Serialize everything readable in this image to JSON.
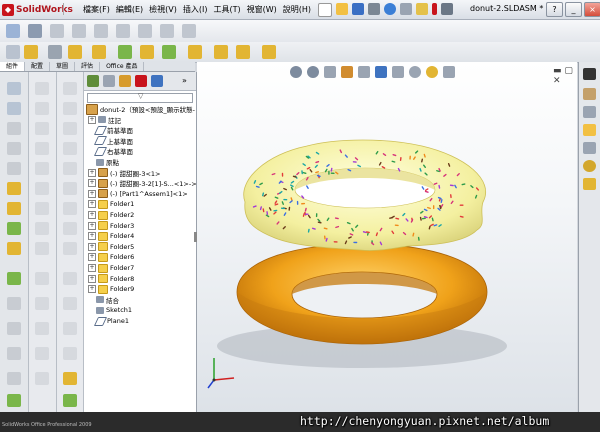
{
  "app": {
    "logo_text": "SolidWorks",
    "document_title": "donut-2.SLDASM *"
  },
  "menus": [
    {
      "label": "檔案(F)"
    },
    {
      "label": "編輯(E)"
    },
    {
      "label": "檢視(V)"
    },
    {
      "label": "插入(I)"
    },
    {
      "label": "工具(T)"
    },
    {
      "label": "視窗(W)"
    },
    {
      "label": "說明(H)"
    }
  ],
  "cmd_tabs": [
    {
      "label": "組件"
    },
    {
      "label": "配置"
    },
    {
      "label": "草圖"
    },
    {
      "label": "評估"
    },
    {
      "label": "Office 產品"
    }
  ],
  "tree": {
    "root": "donut-2（預設<預設_顯示狀態-",
    "nodes": [
      {
        "label": "註記",
        "icon": "annotation-icon",
        "expand": "+"
      },
      {
        "label": "前基準面",
        "icon": "plane-icon",
        "expand": ""
      },
      {
        "label": "上基準面",
        "icon": "plane-icon",
        "expand": ""
      },
      {
        "label": "右基準面",
        "icon": "plane-icon",
        "expand": ""
      },
      {
        "label": "原點",
        "icon": "origin-icon",
        "expand": ""
      },
      {
        "label": "(-) 甜甜圈-3<1>",
        "icon": "part-icon",
        "expand": "+"
      },
      {
        "label": "(-) 甜甜圈-3-2[1]-S...<1>->?",
        "icon": "part-icon",
        "expand": "+"
      },
      {
        "label": "(-) [Part1^Assem1]<1>",
        "icon": "part-icon",
        "expand": "+"
      },
      {
        "label": "Folder1",
        "icon": "folder-icon",
        "expand": "+"
      },
      {
        "label": "Folder2",
        "icon": "folder-icon",
        "expand": "+"
      },
      {
        "label": "Folder3",
        "icon": "folder-icon",
        "expand": "+"
      },
      {
        "label": "Folder4",
        "icon": "folder-icon",
        "expand": "+"
      },
      {
        "label": "Folder5",
        "icon": "folder-icon",
        "expand": "+"
      },
      {
        "label": "Folder6",
        "icon": "folder-icon",
        "expand": "+"
      },
      {
        "label": "Folder7",
        "icon": "folder-icon",
        "expand": "+"
      },
      {
        "label": "Folder8",
        "icon": "folder-icon",
        "expand": "+"
      },
      {
        "label": "Folder9",
        "icon": "folder-icon",
        "expand": "+"
      },
      {
        "label": "結合",
        "icon": "mates-icon",
        "expand": ""
      },
      {
        "label": "Sketch1",
        "icon": "sketch-icon",
        "expand": ""
      },
      {
        "label": "Plane1",
        "icon": "plane-icon",
        "expand": ""
      }
    ]
  },
  "status": {
    "left_text": "SolidWorks Office Professional 2009"
  },
  "watermark": "http://chenyongyuan.pixnet.net/album",
  "colors": {
    "accent": "#c8141c",
    "donut_dough": "#f0a21a",
    "icing": "#f4f0a0"
  }
}
